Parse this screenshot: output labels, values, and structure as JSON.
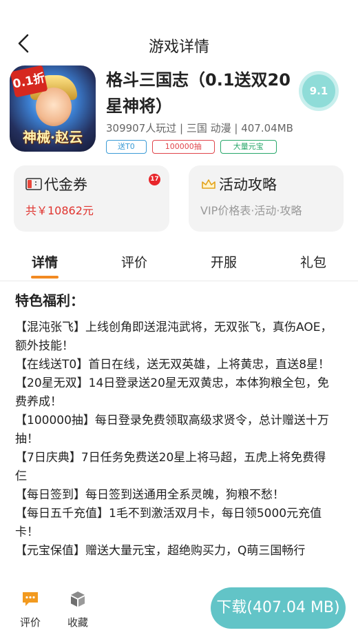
{
  "header": {
    "title": "游戏详情",
    "back_icon": "chevron-left-icon"
  },
  "game": {
    "name": "格斗三国志（0.1送双20星神将）",
    "score": "9.1",
    "meta": "309907人玩过 | 三国 动漫 | 407.04MB",
    "icon_badge": "0.1折",
    "icon_logo": "神械·赵云",
    "tags": [
      "送T0",
      "100000抽",
      "大量元宝"
    ]
  },
  "panels": {
    "voucher": {
      "title": "代金券",
      "subtitle": "共￥10862元",
      "badge": "17",
      "icon": "voucher-icon"
    },
    "guide": {
      "title": "活动攻略",
      "subtitle": "VIP价格表·活动·攻略",
      "icon": "crown-icon"
    }
  },
  "tabs": [
    {
      "label": "详情",
      "active": true
    },
    {
      "label": "评价",
      "active": false
    },
    {
      "label": "开服",
      "active": false
    },
    {
      "label": "礼包",
      "active": false
    }
  ],
  "content": {
    "section_title": "特色福利：",
    "paragraphs": [
      "【混沌张飞】上线创角即送混沌武将，无双张飞，真伤AOE，额外技能！",
      "【在线送T0】首日在线，送无双英雄，上将黄忠，直送8星！",
      "【20星无双】14日登录送20星无双黄忠，本体狗粮全包，免费养成！",
      "【100000抽】每日登录免费领取高级求贤令，总计赠送十万抽！",
      "【7日庆典】7日任务免费送20星上将马超，五虎上将免费得仨",
      "【每日签到】每日签到送通用全系灵魄，狗粮不愁！",
      "【每日五千充值】1毛不到激活双月卡，每日领5000元充值卡！",
      "【元宝保值】赠送大量元宝，超绝购买力，Q萌三国畅行"
    ]
  },
  "bottom_bar": {
    "review_label": "评价",
    "favorite_label": "收藏",
    "download_label": "下载(407.04 MB)"
  },
  "colors": {
    "accent_orange": "#f28a22",
    "download_teal": "#62c4c7",
    "score_teal": "#8fdcd8",
    "price_red": "#e0332e"
  }
}
